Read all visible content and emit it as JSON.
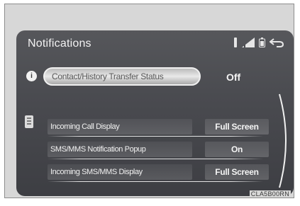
{
  "header": {
    "title": "Notifications"
  },
  "status_bar": {
    "icons": [
      "bluetooth-icon",
      "signal-strength-icon",
      "battery-icon",
      "back-icon"
    ]
  },
  "top_setting": {
    "badge": "i",
    "label": "Contact/History Transfer Status",
    "value": "Off"
  },
  "settings": [
    {
      "label": "Incoming Call Display",
      "value": "Full Screen"
    },
    {
      "label": "SMS/MMS Notification Popup",
      "value": "On"
    },
    {
      "label": "Incoming SMS/MMS Display",
      "value": "Full Screen"
    }
  ],
  "watermark": "CLA5B00RN",
  "colors": {
    "screen_bg": "#4a4b50",
    "text": "#f2f2f2",
    "frame": "#d7d7d7"
  }
}
